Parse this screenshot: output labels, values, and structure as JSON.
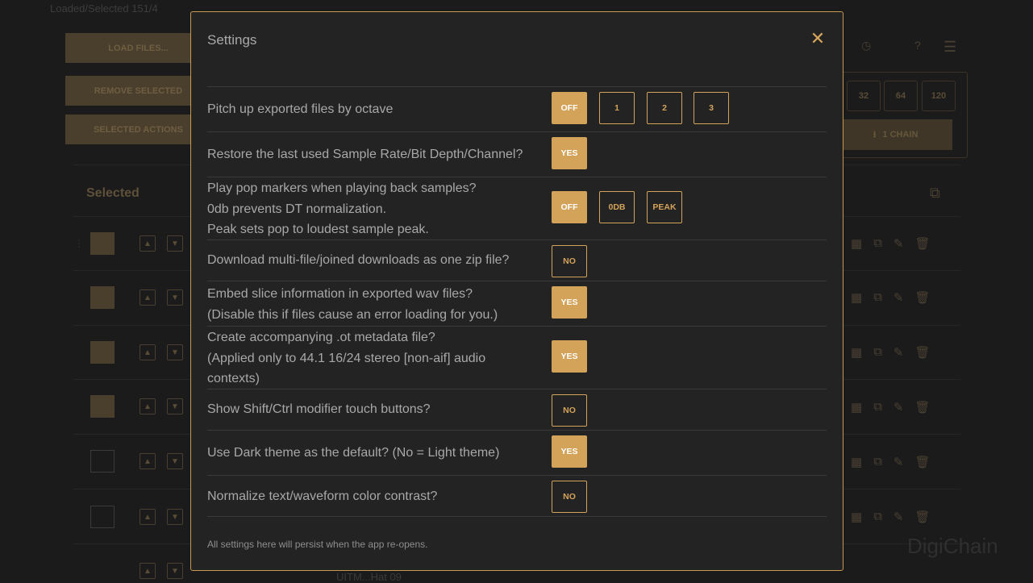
{
  "background": {
    "status_text": "Loaded/Selected 151/4",
    "load_files": "LOAD FILES...",
    "remove_selected": "REMOVE SELECTED",
    "selected_actions": "SELECTED ACTIONS",
    "num_buttons": [
      "32",
      "64",
      "120"
    ],
    "chain_button": "1 CHAIN",
    "selected_header": "Selected",
    "watermark": "DigiChain",
    "bottom_text": "UITM...Hat 09"
  },
  "modal": {
    "title": "Settings",
    "footer": "All settings here will persist when the app re-opens.",
    "settings": [
      {
        "label": "Pitch up exported files by octave",
        "options": [
          {
            "label": "OFF",
            "active": true
          },
          {
            "label": "1",
            "active": false
          },
          {
            "label": "2",
            "active": false
          },
          {
            "label": "3",
            "active": false
          }
        ]
      },
      {
        "label": "Restore the last used Sample Rate/Bit Depth/Channel?",
        "options": [
          {
            "label": "YES",
            "active": true
          }
        ]
      },
      {
        "label": "Play pop markers when playing back samples?\n0db prevents DT normalization.\nPeak sets pop to loudest sample peak.",
        "options": [
          {
            "label": "OFF",
            "active": true
          },
          {
            "label": "0DB",
            "active": false
          },
          {
            "label": "PEAK",
            "active": false
          }
        ]
      },
      {
        "label": "Download multi-file/joined downloads as one zip file?",
        "options": [
          {
            "label": "NO",
            "active": false
          }
        ]
      },
      {
        "label": "Embed slice information in exported wav files?\n(Disable this if files cause an error loading for you.)",
        "options": [
          {
            "label": "YES",
            "active": true
          }
        ]
      },
      {
        "label": "Create accompanying .ot metadata file?\n(Applied only to 44.1 16/24 stereo [non-aif] audio contexts)",
        "options": [
          {
            "label": "YES",
            "active": true
          }
        ]
      },
      {
        "label": "Show Shift/Ctrl modifier touch buttons?",
        "options": [
          {
            "label": "NO",
            "active": false
          }
        ]
      },
      {
        "label": "Use Dark theme as the default? (No = Light theme)",
        "options": [
          {
            "label": "YES",
            "active": true
          }
        ]
      },
      {
        "label": "Normalize text/waveform color contrast?",
        "options": [
          {
            "label": "NO",
            "active": false
          }
        ]
      }
    ]
  }
}
